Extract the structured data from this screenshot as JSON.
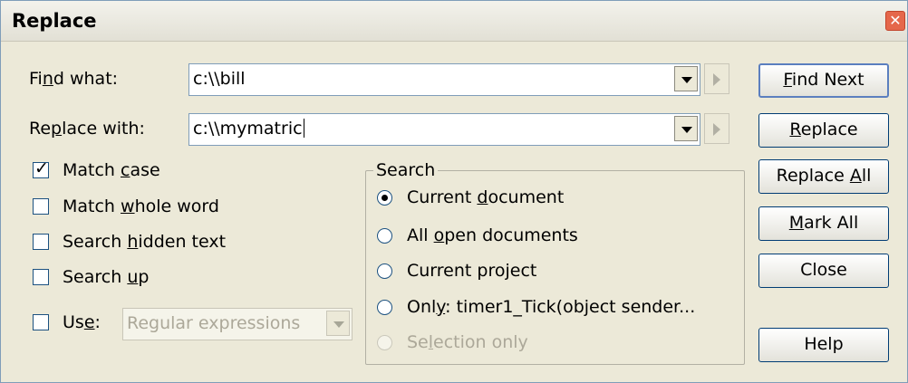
{
  "window": {
    "title": "Replace"
  },
  "find": {
    "label_pre": "Fi",
    "label_key": "n",
    "label_post": "d what:",
    "value": "c:\\\\bill"
  },
  "replace": {
    "label_pre": "Re",
    "label_key": "p",
    "label_post": "lace with:",
    "value": "c:\\\\mymatric"
  },
  "options": {
    "match_case": {
      "pre": "Match ",
      "key": "c",
      "post": "ase",
      "checked": true
    },
    "match_whole_word": {
      "pre": "Match ",
      "key": "w",
      "post": "hole word",
      "checked": false
    },
    "search_hidden_text": {
      "pre": "Search ",
      "key": "h",
      "post": "idden text",
      "checked": false
    },
    "search_up": {
      "pre": "Search ",
      "key": "u",
      "post": "p",
      "checked": false
    },
    "use": {
      "pre": "Us",
      "key": "e",
      "post": ":",
      "checked": false
    },
    "use_select": {
      "value": "Regular expressions"
    }
  },
  "search": {
    "title": "Search",
    "current_document": {
      "pre": "Current ",
      "key": "d",
      "post": "ocument",
      "selected": true
    },
    "all_open_documents": {
      "pre": "All ",
      "key": "o",
      "post": "pen documents"
    },
    "current_project": {
      "pre": "Current pro",
      "key": "j",
      "post": "ect"
    },
    "only": {
      "pre": "Onl",
      "key": "y",
      "post": ": timer1_Tick(object sender..."
    },
    "selection_only": {
      "pre": "Se",
      "key": "l",
      "post": "ection only"
    }
  },
  "buttons": {
    "find_next": {
      "key": "F",
      "post": "ind Next"
    },
    "replace": {
      "key": "R",
      "post": "eplace"
    },
    "replace_all": {
      "pre": "Replace ",
      "key": "A",
      "post": "ll"
    },
    "mark_all": {
      "pre": "",
      "key": "M",
      "post": "ark All"
    },
    "close": "Close",
    "help": "Help"
  },
  "icons": {
    "close": "close-icon",
    "dropdown": "chevron-down-icon",
    "arrow": "chevron-right-icon"
  }
}
